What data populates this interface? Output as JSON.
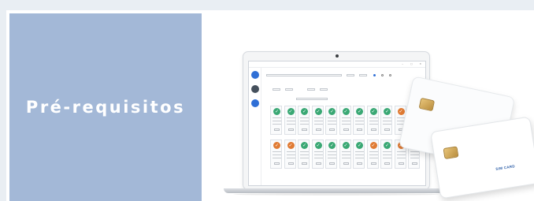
{
  "section": {
    "title": "Pré-requisitos"
  },
  "colors": {
    "page_bg": "#e9eef3",
    "panel_bg": "#a3b8d7",
    "accent_green": "#3aa874",
    "accent_orange": "#e07b34",
    "accent_blue": "#2f6fd6"
  },
  "illustration": {
    "description_icons": [
      "laptop",
      "sim-card",
      "sim-card"
    ],
    "sim_brand": "SIM CARD",
    "cell_check_icon": "check-icon"
  }
}
